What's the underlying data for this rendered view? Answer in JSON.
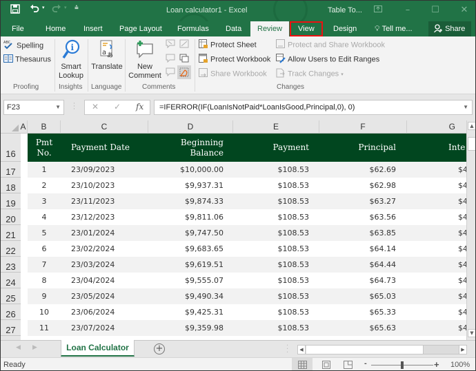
{
  "titlebar": {
    "title": "Loan calculator1 - Excel",
    "context_title": "Table To...",
    "qat": {
      "save_icon": "save-icon",
      "undo_icon": "undo-icon",
      "redo_icon": "redo-icon",
      "customize_icon": "customize-qat-icon"
    },
    "window_buttons": [
      "ribbon-display-options",
      "minimize",
      "maximize",
      "close"
    ]
  },
  "tabs": [
    {
      "label": "File"
    },
    {
      "label": "Home"
    },
    {
      "label": "Insert"
    },
    {
      "label": "Page Layout"
    },
    {
      "label": "Formulas"
    },
    {
      "label": "Data"
    },
    {
      "label": "Review",
      "active": true
    },
    {
      "label": "View",
      "highlighted": true
    },
    {
      "label": "Design"
    },
    {
      "label": "Tell me..."
    }
  ],
  "share_label": "Share",
  "highlight_color": "#e11111",
  "accent_color": "#217346",
  "table_header_color": "#01461f",
  "ribbon": {
    "proofing": {
      "label": "Proofing",
      "spelling": "Spelling",
      "thesaurus": "Thesaurus"
    },
    "insights": {
      "label": "Insights",
      "smart_lookup_1": "Smart",
      "smart_lookup_2": "Lookup"
    },
    "language": {
      "label": "Language",
      "translate": "Translate"
    },
    "comments": {
      "label": "Comments",
      "new_comment_1": "New",
      "new_comment_2": "Comment"
    },
    "changes": {
      "label": "Changes",
      "protect_sheet": "Protect Sheet",
      "protect_workbook": "Protect Workbook",
      "share_workbook": "Share Workbook",
      "protect_share": "Protect and Share Workbook",
      "allow_users": "Allow Users to Edit Ranges",
      "track_changes": "Track Changes"
    }
  },
  "formula_bar": {
    "name_box": "F23",
    "formula": "=IFERROR(IF(LoanIsNotPaid*LoanIsGood,Principal,0), 0)"
  },
  "grid": {
    "columns": [
      "A",
      "B",
      "C",
      "D",
      "E",
      "F",
      "G"
    ],
    "rows": [
      "16",
      "17",
      "18",
      "19",
      "20",
      "21",
      "22",
      "23",
      "24",
      "25",
      "26",
      "27"
    ],
    "table_headers": {
      "pmt_no_1": "Pmt",
      "pmt_no_2": "No.",
      "payment_date": "Payment Date",
      "beginning_balance_1": "Beginning",
      "beginning_balance_2": "Balance",
      "payment": "Payment",
      "principal": "Principal",
      "interest": "Inte"
    },
    "table_rows": [
      {
        "no": "1",
        "date": "23/09/2023",
        "balance": "$10,000.00",
        "payment": "$108.53",
        "principal": "$62.69",
        "interest": "$4"
      },
      {
        "no": "2",
        "date": "23/10/2023",
        "balance": "$9,937.31",
        "payment": "$108.53",
        "principal": "$62.98",
        "interest": "$4"
      },
      {
        "no": "3",
        "date": "23/11/2023",
        "balance": "$9,874.33",
        "payment": "$108.53",
        "principal": "$63.27",
        "interest": "$4"
      },
      {
        "no": "4",
        "date": "23/12/2023",
        "balance": "$9,811.06",
        "payment": "$108.53",
        "principal": "$63.56",
        "interest": "$4"
      },
      {
        "no": "5",
        "date": "23/01/2024",
        "balance": "$9,747.50",
        "payment": "$108.53",
        "principal": "$63.85",
        "interest": "$4"
      },
      {
        "no": "6",
        "date": "23/02/2024",
        "balance": "$9,683.65",
        "payment": "$108.53",
        "principal": "$64.14",
        "interest": "$4"
      },
      {
        "no": "7",
        "date": "23/03/2024",
        "balance": "$9,619.51",
        "payment": "$108.53",
        "principal": "$64.44",
        "interest": "$4"
      },
      {
        "no": "8",
        "date": "23/04/2024",
        "balance": "$9,555.07",
        "payment": "$108.53",
        "principal": "$64.73",
        "interest": "$4"
      },
      {
        "no": "9",
        "date": "23/05/2024",
        "balance": "$9,490.34",
        "payment": "$108.53",
        "principal": "$65.03",
        "interest": "$4"
      },
      {
        "no": "10",
        "date": "23/06/2024",
        "balance": "$9,425.31",
        "payment": "$108.53",
        "principal": "$65.33",
        "interest": "$4"
      },
      {
        "no": "11",
        "date": "23/07/2024",
        "balance": "$9,359.98",
        "payment": "$108.53",
        "principal": "$65.63",
        "interest": "$4"
      }
    ]
  },
  "sheet_tabs": {
    "active": "Loan Calculator",
    "add_label": "+"
  },
  "status": {
    "text": "Ready",
    "zoom": "100%",
    "zoom_fraction": 0.5
  }
}
